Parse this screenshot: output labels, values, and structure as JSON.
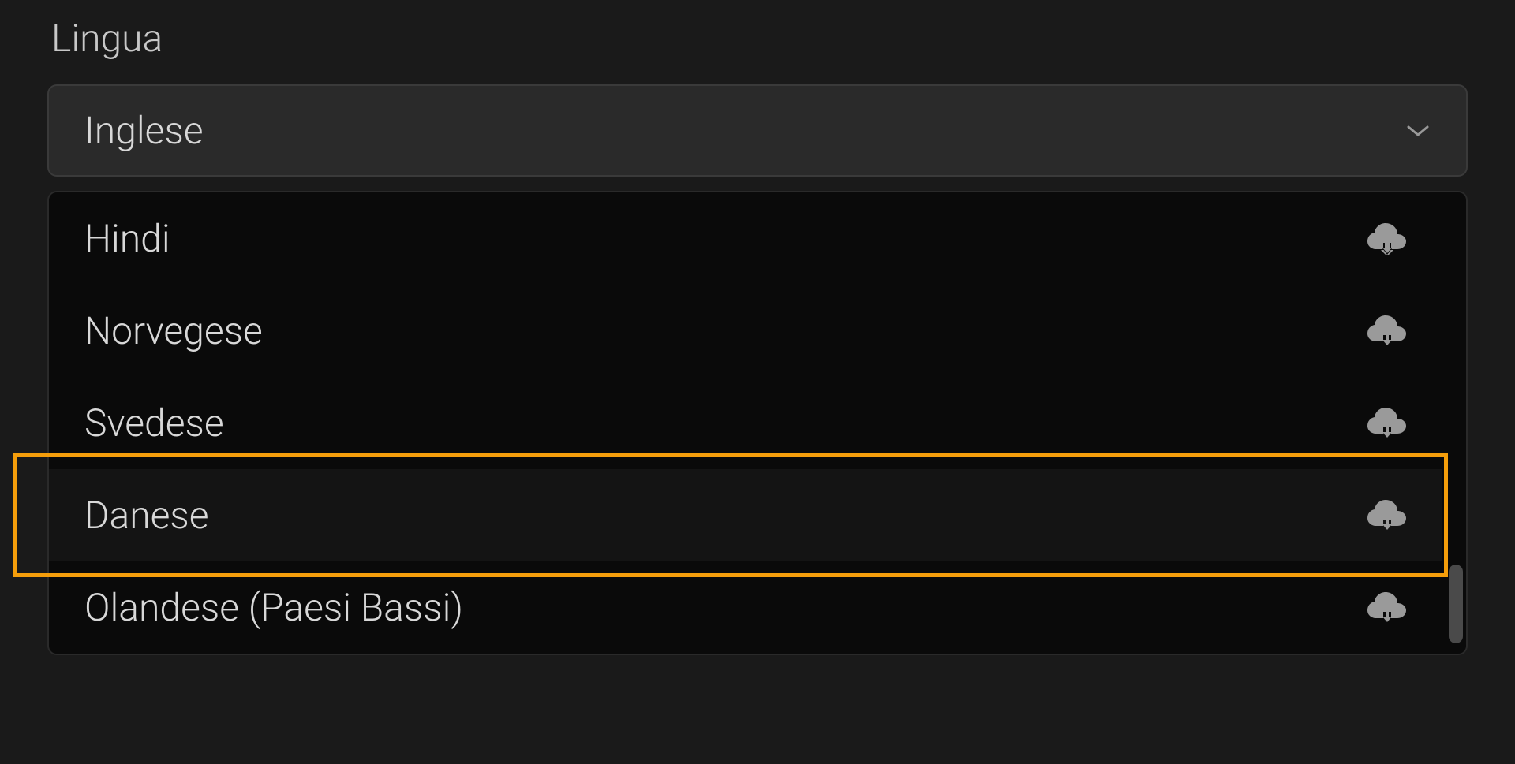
{
  "label": "Lingua",
  "selected": "Inglese",
  "options": [
    {
      "name": "Hindi"
    },
    {
      "name": "Norvegese"
    },
    {
      "name": "Svedese"
    },
    {
      "name": "Danese"
    },
    {
      "name": "Olandese (Paesi Bassi)"
    }
  ],
  "highlighted_index": 3
}
